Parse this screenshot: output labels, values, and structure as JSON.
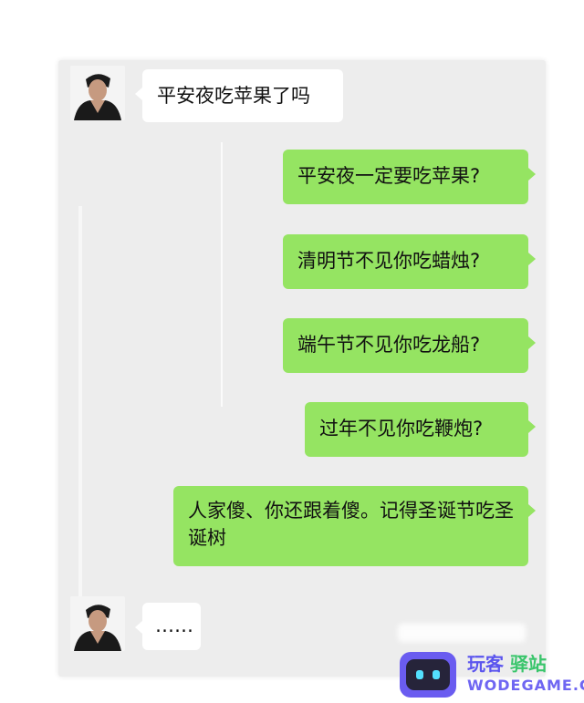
{
  "chat": {
    "messages": [
      {
        "side": "in",
        "text": "平安夜吃苹果了吗"
      },
      {
        "side": "out",
        "text": "平安夜一定要吃苹果?"
      },
      {
        "side": "out",
        "text": "清明节不见你吃蜡烛?"
      },
      {
        "side": "out",
        "text": "端午节不见你吃龙船?"
      },
      {
        "side": "out",
        "text": "过年不见你吃鞭炮?"
      },
      {
        "side": "out",
        "text": "人家傻、你还跟着傻。记得圣诞节吃圣诞树"
      },
      {
        "side": "in",
        "text": "……"
      }
    ]
  },
  "watermark": {
    "brand_a": "玩客",
    "brand_b": "驿站",
    "domain": "WODEGAME.CN"
  },
  "colors": {
    "chat_bg": "#ededed",
    "bubble_out": "#95e462",
    "bubble_in": "#ffffff"
  },
  "icons": {
    "avatar": "person-avatar",
    "watermark": "robot-logo-icon"
  }
}
